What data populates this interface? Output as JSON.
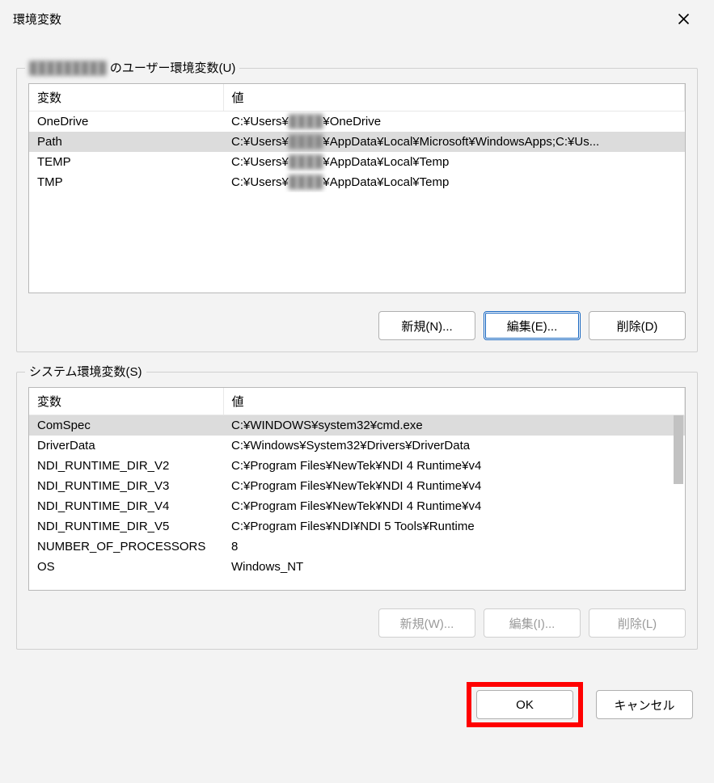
{
  "window": {
    "title": "環境変数"
  },
  "user_section": {
    "label_prefix": "█████████",
    "label_suffix": " のユーザー環境変数(U)",
    "col_variable": "変数",
    "col_value": "値",
    "rows": [
      {
        "var": "OneDrive",
        "val_prefix": "C:¥Users¥",
        "val_blur": "████",
        "val_suffix": "¥OneDrive",
        "selected": false
      },
      {
        "var": "Path",
        "val_prefix": "C:¥Users¥",
        "val_blur": "████",
        "val_suffix": "¥AppData¥Local¥Microsoft¥WindowsApps;C:¥Us...",
        "selected": true
      },
      {
        "var": "TEMP",
        "val_prefix": "C:¥Users¥",
        "val_blur": "████",
        "val_suffix": "¥AppData¥Local¥Temp",
        "selected": false
      },
      {
        "var": "TMP",
        "val_prefix": "C:¥Users¥",
        "val_blur": "████",
        "val_suffix": "¥AppData¥Local¥Temp",
        "selected": false
      }
    ],
    "btn_new": "新規(N)...",
    "btn_edit": "編集(E)...",
    "btn_delete": "削除(D)"
  },
  "system_section": {
    "label": "システム環境変数(S)",
    "col_variable": "変数",
    "col_value": "値",
    "rows": [
      {
        "var": "ComSpec",
        "val": "C:¥WINDOWS¥system32¥cmd.exe",
        "selected": true
      },
      {
        "var": "DriverData",
        "val": "C:¥Windows¥System32¥Drivers¥DriverData",
        "selected": false
      },
      {
        "var": "NDI_RUNTIME_DIR_V2",
        "val": "C:¥Program Files¥NewTek¥NDI 4 Runtime¥v4",
        "selected": false
      },
      {
        "var": "NDI_RUNTIME_DIR_V3",
        "val": "C:¥Program Files¥NewTek¥NDI 4 Runtime¥v4",
        "selected": false
      },
      {
        "var": "NDI_RUNTIME_DIR_V4",
        "val": "C:¥Program Files¥NewTek¥NDI 4 Runtime¥v4",
        "selected": false
      },
      {
        "var": "NDI_RUNTIME_DIR_V5",
        "val": "C:¥Program Files¥NDI¥NDI 5 Tools¥Runtime",
        "selected": false
      },
      {
        "var": "NUMBER_OF_PROCESSORS",
        "val": "8",
        "selected": false
      },
      {
        "var": "OS",
        "val": "Windows_NT",
        "selected": false
      }
    ],
    "btn_new": "新規(W)...",
    "btn_edit": "編集(I)...",
    "btn_delete": "削除(L)"
  },
  "dialog": {
    "ok": "OK",
    "cancel": "キャンセル"
  }
}
